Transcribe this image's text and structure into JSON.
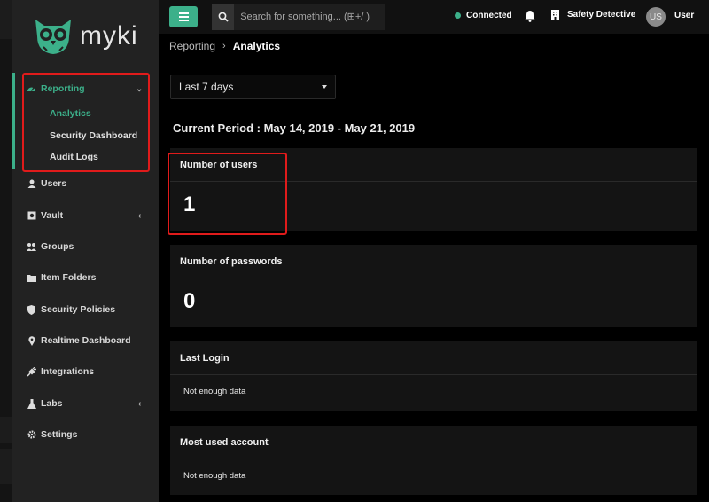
{
  "brand": {
    "name": "myki"
  },
  "sidebar": {
    "reporting": {
      "label": "Reporting",
      "icon": "dashboard-icon",
      "children": [
        {
          "label": "Analytics",
          "active": true
        },
        {
          "label": "Security Dashboard"
        },
        {
          "label": "Audit Logs"
        }
      ]
    },
    "items": [
      {
        "label": "Users",
        "icon": "user-icon"
      },
      {
        "label": "Vault",
        "icon": "vault-icon",
        "has_chevron": true
      },
      {
        "label": "Groups",
        "icon": "users-icon"
      },
      {
        "label": "Item Folders",
        "icon": "folder-icon"
      },
      {
        "label": "Security Policies",
        "icon": "shield-icon"
      },
      {
        "label": "Realtime Dashboard",
        "icon": "location-pin-icon"
      },
      {
        "label": "Integrations",
        "icon": "plug-icon"
      },
      {
        "label": "Labs",
        "icon": "flask-icon",
        "has_chevron": true
      },
      {
        "label": "Settings",
        "icon": "gear-icon"
      }
    ]
  },
  "topbar": {
    "search_placeholder": "Search for something... (⊞+/ )",
    "status": "Connected",
    "company": "Safety Detective",
    "avatar_initials": "US",
    "user": "User"
  },
  "breadcrumb": {
    "parent": "Reporting",
    "current": "Analytics"
  },
  "filter": {
    "selected": "Last 7 days"
  },
  "period": "Current Period : May 14, 2019 - May 21, 2019",
  "cards": {
    "users": {
      "title": "Number of users",
      "value": "1"
    },
    "passwords": {
      "title": "Number of passwords",
      "value": "0"
    },
    "last_login": {
      "title": "Last Login",
      "value": "Not enough data"
    },
    "most_used": {
      "title": "Most used account",
      "value": "Not enough data"
    }
  },
  "colors": {
    "accent": "#3cb08a",
    "highlight": "#e01b1b",
    "sidebar_bg": "#222222",
    "main_bg": "#000000"
  }
}
